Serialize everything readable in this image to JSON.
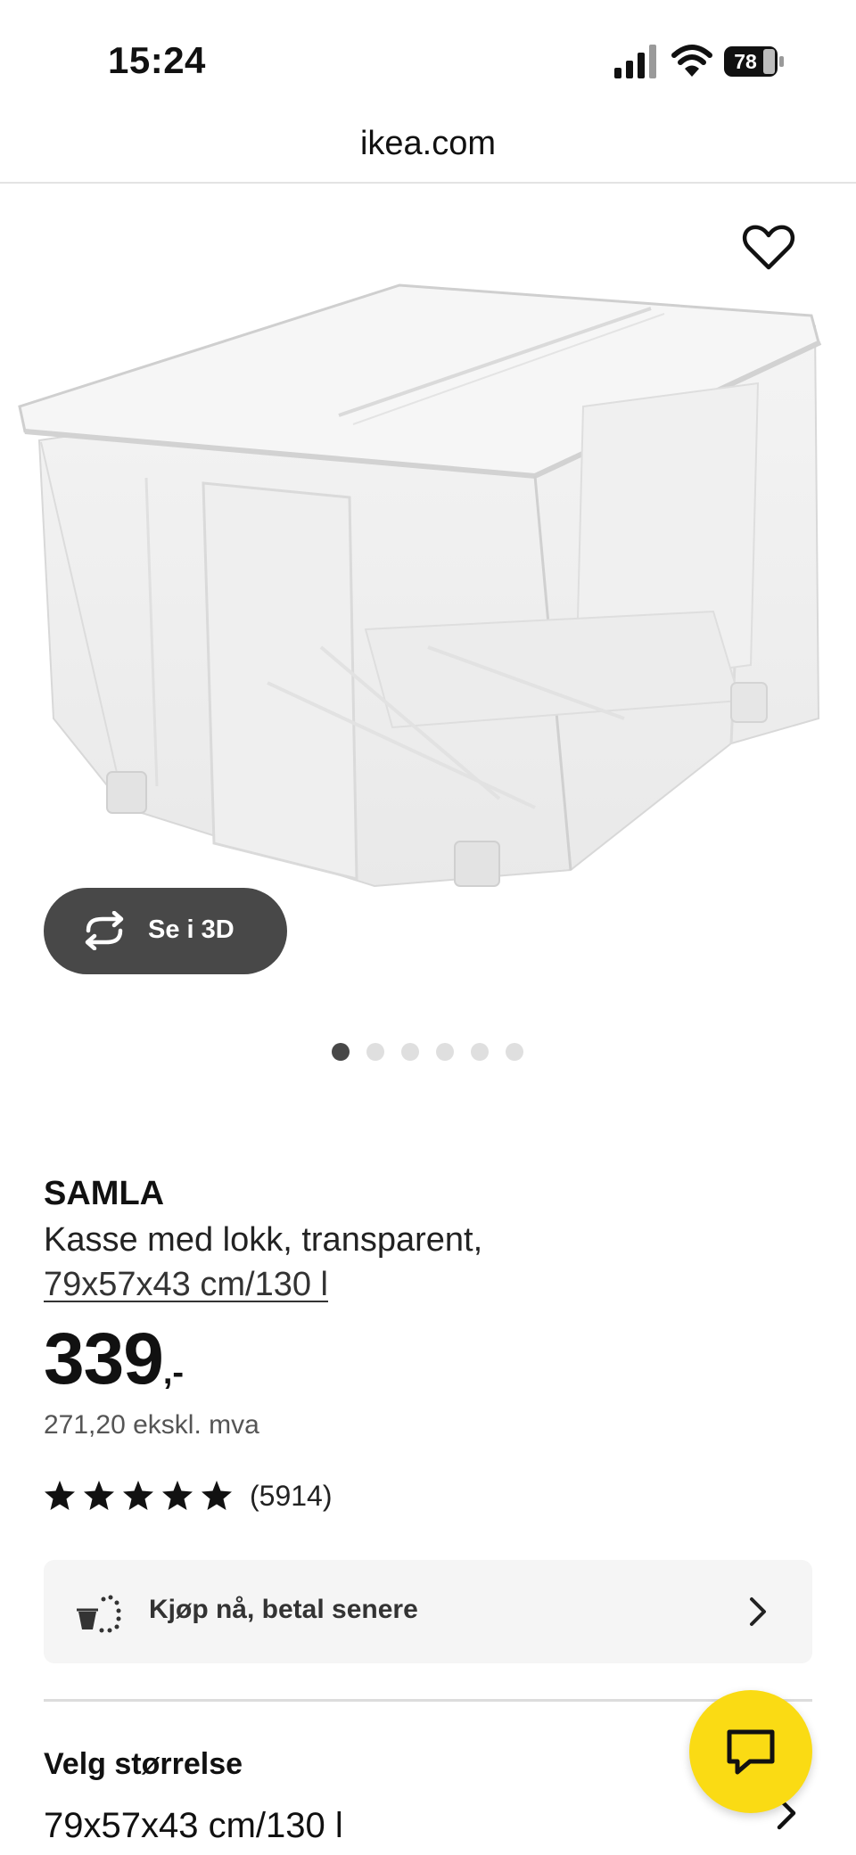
{
  "status_bar": {
    "time": "15:24",
    "battery_level": "78",
    "icons": [
      "signal-icon",
      "wifi-icon",
      "battery-icon"
    ]
  },
  "browser": {
    "url": "ikea.com"
  },
  "gallery": {
    "view_3d_label": "Se i 3D",
    "total_images": 6,
    "active_index": 0,
    "icons": [
      "heart-icon",
      "rotate-3d-icon"
    ]
  },
  "product": {
    "name": "SAMLA",
    "description": "Kasse med lokk, transparent,",
    "size_link": "79x57x43 cm/130 l",
    "price": "339",
    "price_suffix": ",-",
    "price_ex_vat": "271,20 ekskl. mva",
    "rating_stars": 5,
    "rating_count": "(5914)"
  },
  "financing": {
    "label": "Kjøp nå, betal senere",
    "icons": [
      "pay-later-icon",
      "chevron-right-icon"
    ]
  },
  "size_selector": {
    "heading": "Velg størrelse",
    "value": "79x57x43 cm/130 l"
  },
  "chat": {
    "icon": "chat-icon",
    "color": "#fadb14"
  },
  "colors": {
    "accent_dark": "#484848",
    "chat_yellow": "#fadb14",
    "panel_bg": "#f5f5f5"
  }
}
